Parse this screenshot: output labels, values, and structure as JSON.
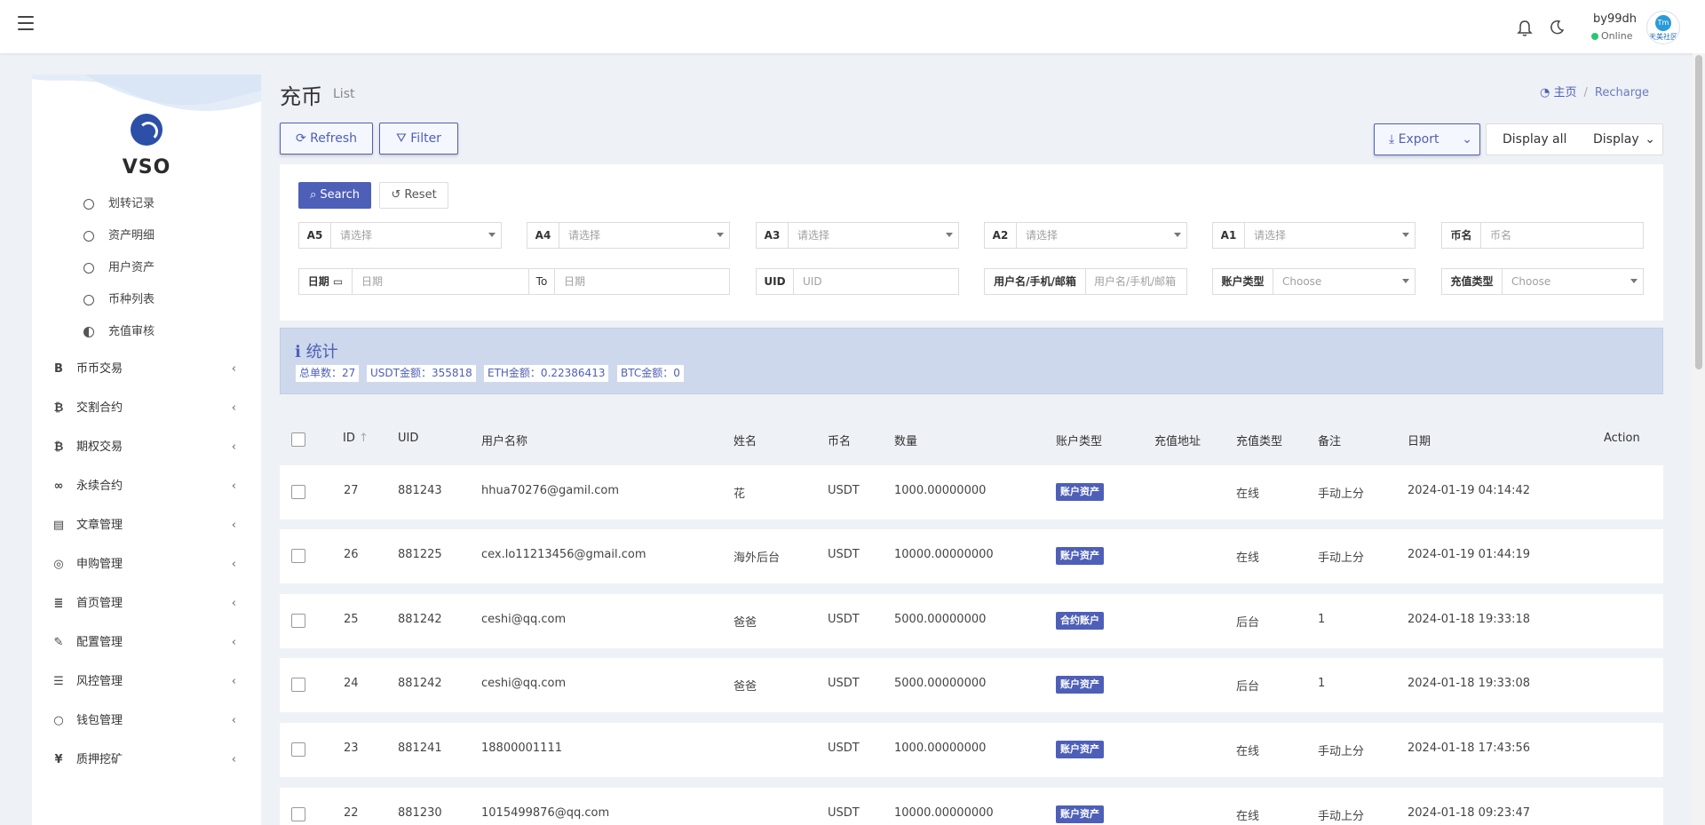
{
  "header": {
    "user_name": "by99dh",
    "status": "Online",
    "avatar_text_top": "Tm",
    "avatar_text_bottom": "天美社区",
    "icons": [
      "menu-icon",
      "bell-icon",
      "moon-icon"
    ]
  },
  "sidebar": {
    "brand": "VSO",
    "sub_items": [
      {
        "label": "划转记录"
      },
      {
        "label": "资产明细"
      },
      {
        "label": "用户资产"
      },
      {
        "label": "币种列表"
      },
      {
        "label": "充值审核"
      }
    ],
    "menu": [
      {
        "icon": "B",
        "label": "币币交易"
      },
      {
        "icon": "₿",
        "label": "交割合约"
      },
      {
        "icon": "₿",
        "label": "期权交易"
      },
      {
        "icon": "∞",
        "label": "永续合约"
      },
      {
        "icon": "▤",
        "label": "文章管理"
      },
      {
        "icon": "◎",
        "label": "申购管理"
      },
      {
        "icon": "≣",
        "label": "首页管理"
      },
      {
        "icon": "✎",
        "label": "配置管理"
      },
      {
        "icon": "☰",
        "label": "风控管理"
      },
      {
        "icon": "○",
        "label": "钱包管理"
      },
      {
        "icon": "¥",
        "label": "质押挖矿"
      }
    ]
  },
  "page": {
    "title": "充币",
    "subtitle": "List",
    "breadcrumb": {
      "home": "主页",
      "current": "Recharge"
    }
  },
  "toolbar": {
    "refresh": "Refresh",
    "filter": "Filter",
    "export": "Export",
    "display_all": "Display all",
    "display": "Display"
  },
  "filters": {
    "search": "Search",
    "reset": "Reset",
    "a5": {
      "label": "A5",
      "placeholder": "请选择"
    },
    "a4": {
      "label": "A4",
      "placeholder": "请选择"
    },
    "a3": {
      "label": "A3",
      "placeholder": "请选择"
    },
    "a2": {
      "label": "A2",
      "placeholder": "请选择"
    },
    "a1": {
      "label": "A1",
      "placeholder": "请选择"
    },
    "coin": {
      "label": "币名",
      "placeholder": "币名"
    },
    "date": {
      "label": "日期",
      "from_placeholder": "日期",
      "to": "To",
      "to_placeholder": "日期"
    },
    "uid": {
      "label": "UID",
      "placeholder": "UID"
    },
    "account": {
      "label": "用户名/手机/邮箱",
      "placeholder": "用户名/手机/邮箱"
    },
    "account_type": {
      "label": "账户类型",
      "placeholder": "Choose"
    },
    "recharge_type": {
      "label": "充值类型",
      "placeholder": "Choose"
    }
  },
  "stats": {
    "title": "统计",
    "chips": [
      "总单数：27",
      "USDT金额：355818",
      "ETH金额：0.22386413",
      "BTC金额：0"
    ]
  },
  "table": {
    "columns": [
      "ID",
      "UID",
      "用户名称",
      "姓名",
      "币名",
      "数量",
      "账户类型",
      "充值地址",
      "充值类型",
      "备注",
      "日期",
      "Action"
    ],
    "rows": [
      {
        "id": "27",
        "uid": "881243",
        "username": "hhua70276@gamil.com",
        "name": "花",
        "coin": "USDT",
        "amount": "1000.00000000",
        "account_type": "账户资产",
        "address": "",
        "recharge_type": "在线",
        "remark": "手动上分",
        "date": "2024-01-19 04:14:42"
      },
      {
        "id": "26",
        "uid": "881225",
        "username": "cex.lo11213456@gmail.com",
        "name": "海外后台",
        "coin": "USDT",
        "amount": "10000.00000000",
        "account_type": "账户资产",
        "address": "",
        "recharge_type": "在线",
        "remark": "手动上分",
        "date": "2024-01-19 01:44:19"
      },
      {
        "id": "25",
        "uid": "881242",
        "username": "ceshi@qq.com",
        "name": "爸爸",
        "coin": "USDT",
        "amount": "5000.00000000",
        "account_type": "合约账户",
        "address": "",
        "recharge_type": "后台",
        "remark": "1",
        "date": "2024-01-18 19:33:18"
      },
      {
        "id": "24",
        "uid": "881242",
        "username": "ceshi@qq.com",
        "name": "爸爸",
        "coin": "USDT",
        "amount": "5000.00000000",
        "account_type": "账户资产",
        "address": "",
        "recharge_type": "后台",
        "remark": "1",
        "date": "2024-01-18 19:33:08"
      },
      {
        "id": "23",
        "uid": "881241",
        "username": "18800001111",
        "name": "",
        "coin": "USDT",
        "amount": "1000.00000000",
        "account_type": "账户资产",
        "address": "",
        "recharge_type": "在线",
        "remark": "手动上分",
        "date": "2024-01-18 17:43:56"
      },
      {
        "id": "22",
        "uid": "881230",
        "username": "1015499876@qq.com",
        "name": "",
        "coin": "USDT",
        "amount": "10000.00000000",
        "account_type": "账户资产",
        "address": "",
        "recharge_type": "在线",
        "remark": "手动上分",
        "date": "2024-01-18 09:23:47"
      }
    ]
  },
  "colors": {
    "accent": "#4e5fb8",
    "online": "#28c76f",
    "stat_bg": "#cdd8ec"
  }
}
